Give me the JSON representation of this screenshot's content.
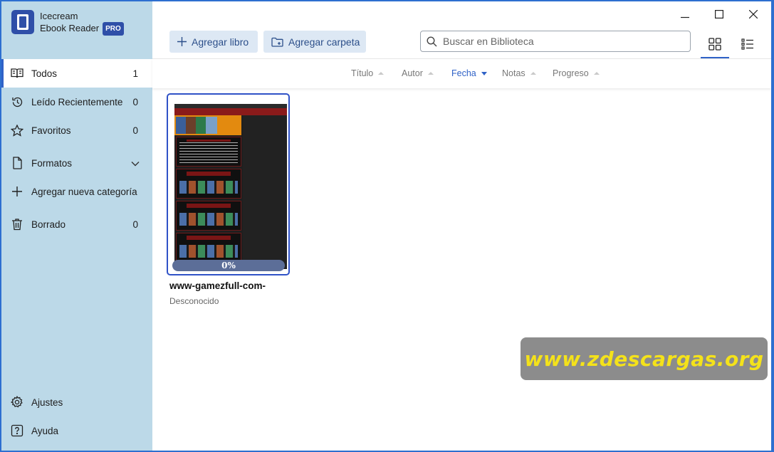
{
  "brand": {
    "line1": "Icecream",
    "line2": "Ebook Reader",
    "badge": "PRO"
  },
  "sidebar": {
    "items": [
      {
        "label": "Todos",
        "count": "1"
      },
      {
        "label": "Leído Recientemente",
        "count": "0"
      },
      {
        "label": "Favoritos",
        "count": "0"
      },
      {
        "label": "Formatos"
      },
      {
        "label": "Agregar nueva categoría"
      },
      {
        "label": "Borrado",
        "count": "0"
      }
    ],
    "bottom": [
      {
        "label": "Ajustes"
      },
      {
        "label": "Ayuda"
      }
    ]
  },
  "toolbar": {
    "add_book": "Agregar libro",
    "add_folder": "Agregar carpeta",
    "search_placeholder": "Buscar en Biblioteca"
  },
  "sort": {
    "columns": [
      "Título",
      "Autor",
      "Fecha",
      "Notas",
      "Progreso"
    ],
    "active": "Fecha"
  },
  "book": {
    "title": "www-gamezfull-com-",
    "author": "Desconocido",
    "progress": "0%"
  },
  "watermark": "www.zdescargas.org",
  "colors": {
    "accent": "#2f62c7",
    "sidebar_bg": "#bcd9e8",
    "button_bg": "#dde8f4"
  }
}
